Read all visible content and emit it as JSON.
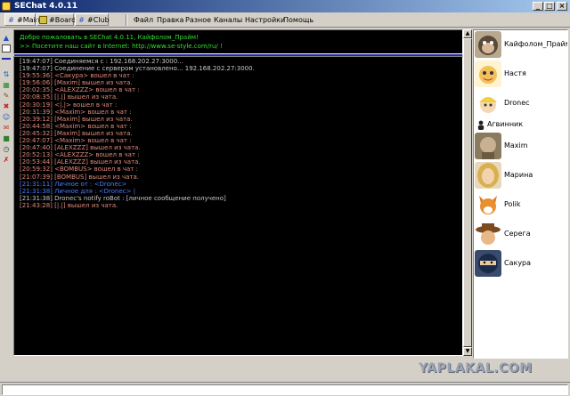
{
  "window": {
    "title": "SEChat 4.0.11",
    "controls": [
      "_",
      "□",
      "×"
    ]
  },
  "tabs": [
    {
      "label": "#Main",
      "icon": "hash-icon"
    },
    {
      "label": "#Board",
      "icon": "board-icon"
    },
    {
      "label": "#Club",
      "icon": "club-icon"
    }
  ],
  "menu": [
    "Файл",
    "Правка",
    "Разное",
    "Каналы",
    "Настройки",
    "Помощь"
  ],
  "welcome": {
    "line1": "Добро пожаловать в SEChat 4.0.11, Кайфолом_Прайм!",
    "line2": ">> Посетите наш сайт в Internet: http://www.se-style.com/ru/ !"
  },
  "colors": {
    "system": "#c8c8c8",
    "event": "#e08a7a",
    "private": "#4a7aff",
    "welcome": "#33dd33",
    "accent_line": "#1d2bb0"
  },
  "messages": [
    {
      "text": "[19:47:07] Соединяемся с : 192.168.202.27:3000...",
      "kind": "system"
    },
    {
      "text": "[19:47:07] Соединение с сервером установлено... 192.168.202.27:3000.",
      "kind": "system"
    },
    {
      "text": "[19:55:36] <Сакура> вошел в чат :",
      "kind": "event"
    },
    {
      "text": "[19:56:06] [Maxim] вышел из чата.",
      "kind": "event"
    },
    {
      "text": "[20:02:35] <ALEXZZZ> вошел в чат :",
      "kind": "event"
    },
    {
      "text": "[20:08:35] [|.|] вышел из чата.",
      "kind": "event"
    },
    {
      "text": "[20:30:19] <|.|> вошел в чат :",
      "kind": "event"
    },
    {
      "text": "[20:31:39] <Maxim> вошел в чат :",
      "kind": "event"
    },
    {
      "text": "[20:39:12] [Maxim] вышел из чата.",
      "kind": "event"
    },
    {
      "text": "[20:44:58] <Maxim> вошел в чат :",
      "kind": "event"
    },
    {
      "text": "[20:45:32] [Maxim] вышел из чата.",
      "kind": "event"
    },
    {
      "text": "[20:47:07] <Maxim> вошел в чат :",
      "kind": "event"
    },
    {
      "text": "[20:47:40] [ALEXZZZ] вышел из чата.",
      "kind": "event"
    },
    {
      "text": "[20:52:13] <ALEXZZZ> вошел в чат :",
      "kind": "event"
    },
    {
      "text": "[20:53:44] [ALEXZZZ] вышел из чата.",
      "kind": "event"
    },
    {
      "text": "[20:59:32] <BOMBUS> вошел в чат :",
      "kind": "event"
    },
    {
      "text": "[21:07:39] [BOMBUS] вышел из чата.",
      "kind": "event"
    },
    {
      "text": "[21:31:11] Личное от : <Dronec>",
      "kind": "private"
    },
    {
      "text": "[21:31:38] Личное для : <Dronec> |",
      "kind": "private"
    },
    {
      "text": "[21:31:38] Dronec's notify roBot : [личное сообщение получено]",
      "kind": "system"
    },
    {
      "text": "[21:43:28] [|.|] вышел из чата.",
      "kind": "event"
    }
  ],
  "users": [
    {
      "name": "Кайфолом_Прайм",
      "avatar": "monkey-avatar-icon",
      "size": "big"
    },
    {
      "name": "Настя",
      "avatar": "cartoon-girl-avatar-icon",
      "size": "big"
    },
    {
      "name": "Dronec",
      "avatar": "blonde-cartoon-avatar-icon",
      "size": "big"
    },
    {
      "name": "Агвинник",
      "avatar": "person-silhouette-icon",
      "size": "small"
    },
    {
      "name": "Maxim",
      "avatar": "sepia-person-avatar-icon",
      "size": "big"
    },
    {
      "name": "Марина",
      "avatar": "blonde-woman-avatar-icon",
      "size": "big"
    },
    {
      "name": "Polik",
      "avatar": "fox-avatar-icon",
      "size": "big"
    },
    {
      "name": "Серега",
      "avatar": "cowboy-avatar-icon",
      "size": "big"
    },
    {
      "name": "Сакура",
      "avatar": "ninja-avatar-icon",
      "size": "big"
    }
  ],
  "watermark": "YAPLAKAL.COM"
}
